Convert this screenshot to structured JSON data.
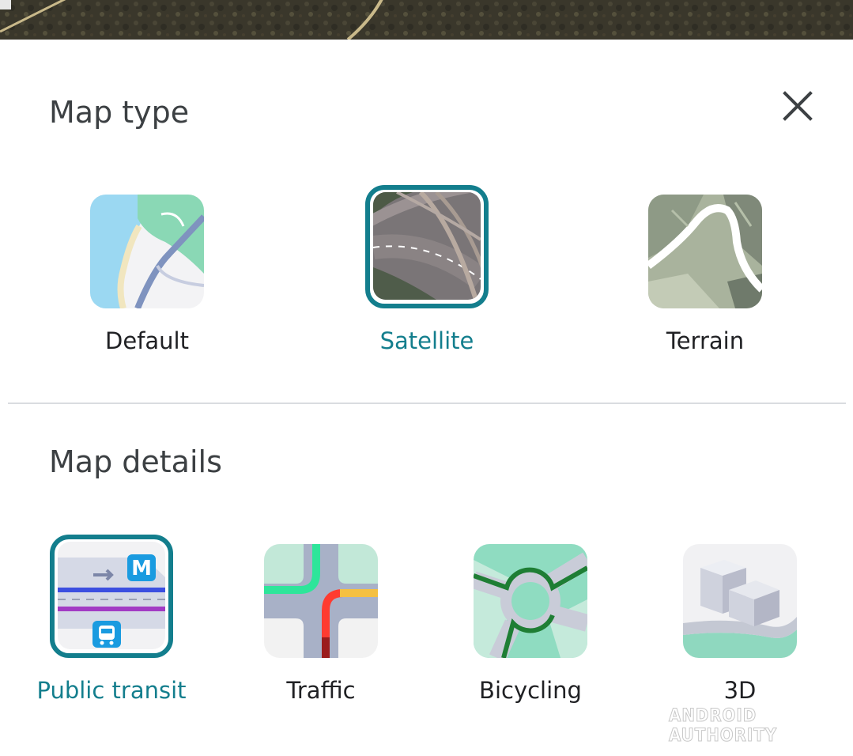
{
  "map_type": {
    "title": "Map type",
    "options": [
      {
        "label": "Default",
        "icon": "default-map-icon",
        "selected": false
      },
      {
        "label": "Satellite",
        "icon": "satellite-map-icon",
        "selected": true
      },
      {
        "label": "Terrain",
        "icon": "terrain-map-icon",
        "selected": false
      }
    ]
  },
  "map_details": {
    "title": "Map details",
    "options": [
      {
        "label": "Public transit",
        "icon": "public-transit-icon",
        "selected": true
      },
      {
        "label": "Traffic",
        "icon": "traffic-icon",
        "selected": false
      },
      {
        "label": "Bicycling",
        "icon": "bicycling-icon",
        "selected": false
      },
      {
        "label": "3D",
        "icon": "3d-buildings-icon",
        "selected": false
      }
    ]
  },
  "close_icon": "close-icon",
  "watermark": "ANDROID AUTHORITY",
  "colors": {
    "accent": "#137e8d",
    "heading": "#3c4043",
    "label": "#202124",
    "divider": "#dadce0"
  }
}
